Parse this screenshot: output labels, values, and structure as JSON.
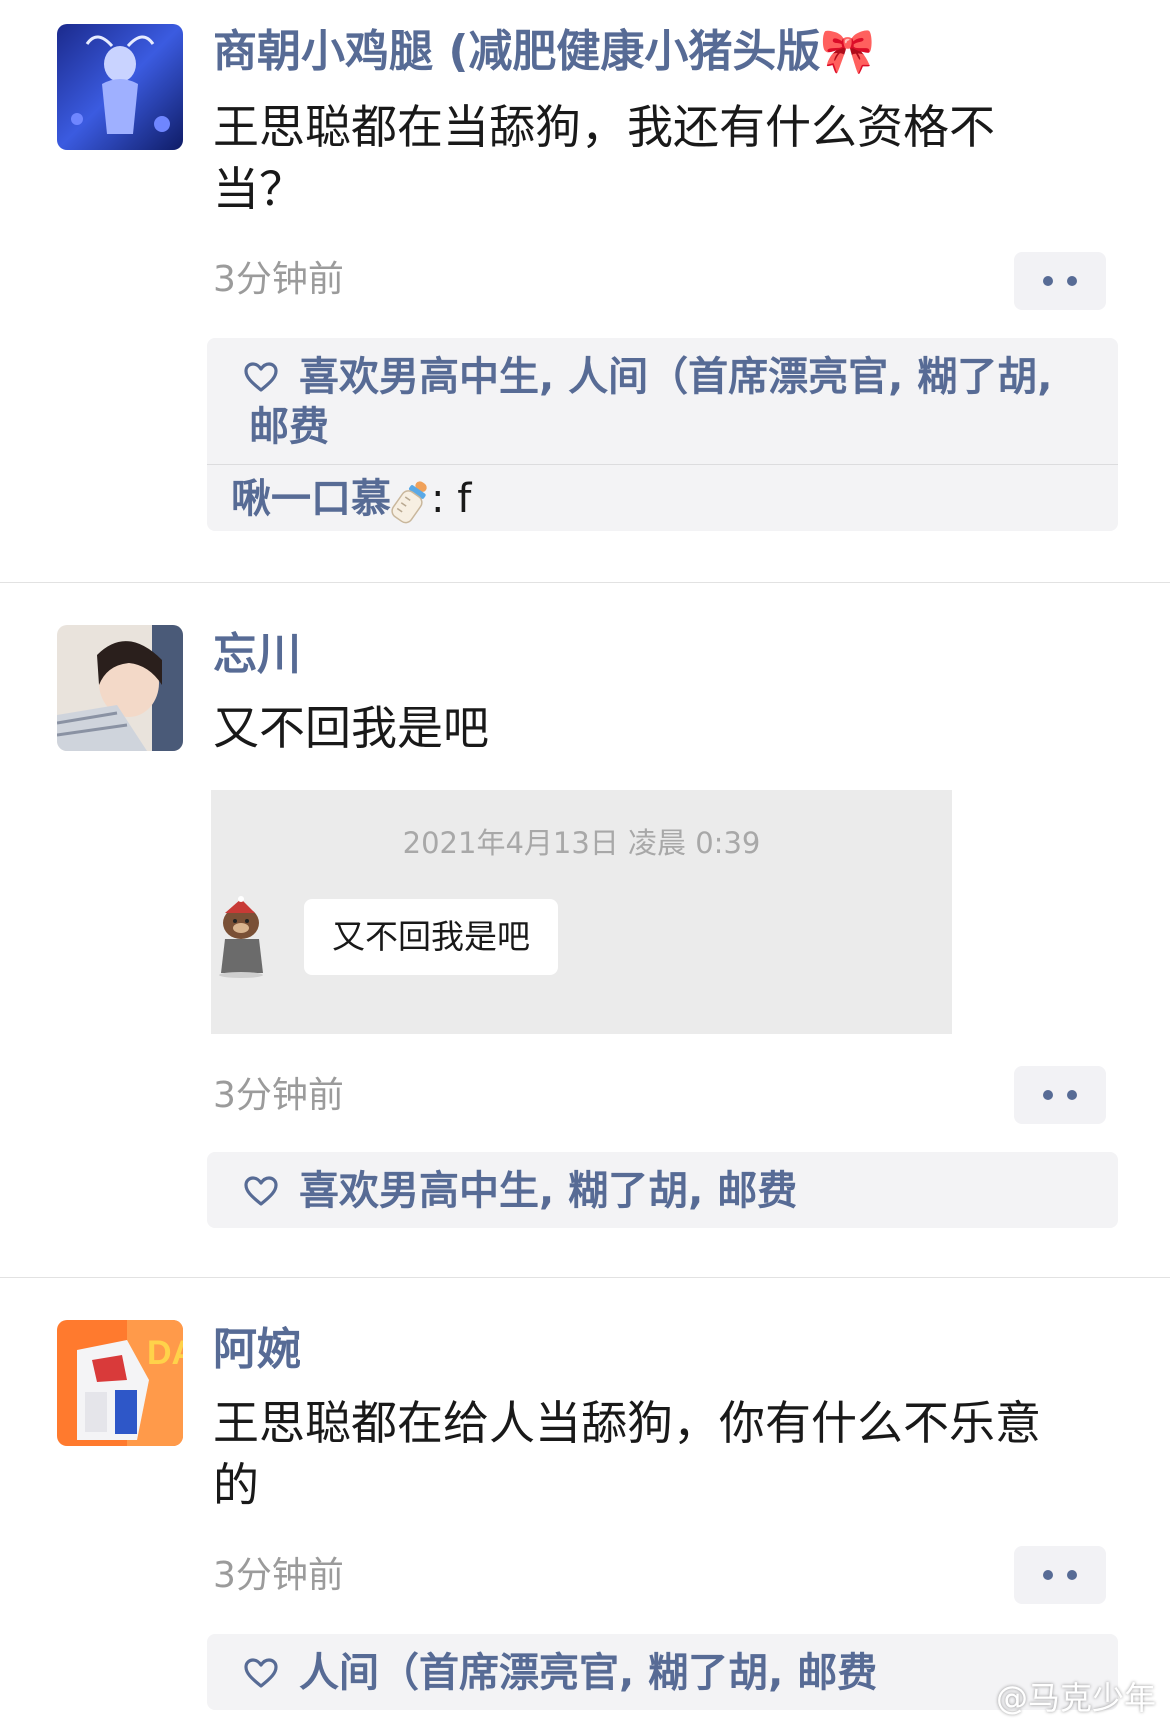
{
  "posts": [
    {
      "name": "商朝小鸡腿 (减肥健康小猪头版🎀",
      "text": "王思聪都在当舔狗，我还有什么资格不当？",
      "time": "3分钟前",
      "likes": "喜欢男高中生, 人间（首席漂亮官, 糊了胡, 邮费",
      "reply": {
        "name": "啾一口慕",
        "text": ": f"
      }
    },
    {
      "name": "忘川",
      "text": "又不回我是吧",
      "time": "3分钟前",
      "likes": "喜欢男高中生, 糊了胡, 邮费",
      "image": {
        "date": "2021年4月13日 凌晨 0:39",
        "bubble": "又不回我是吧"
      }
    },
    {
      "name": "阿婉",
      "text": "王思聪都在给人当舔狗，你有什么不乐意的",
      "time": "3分钟前",
      "likes": "人间（首席漂亮官, 糊了胡, 邮费"
    }
  ],
  "watermark": "@马克少年",
  "icons": {
    "like": "heart-outline-icon",
    "more": "more-dots-icon",
    "bottle": "baby-bottle-icon"
  },
  "colors": {
    "link": "#576b95",
    "like_bg": "#f3f3f5",
    "time": "#9b9b9b"
  }
}
